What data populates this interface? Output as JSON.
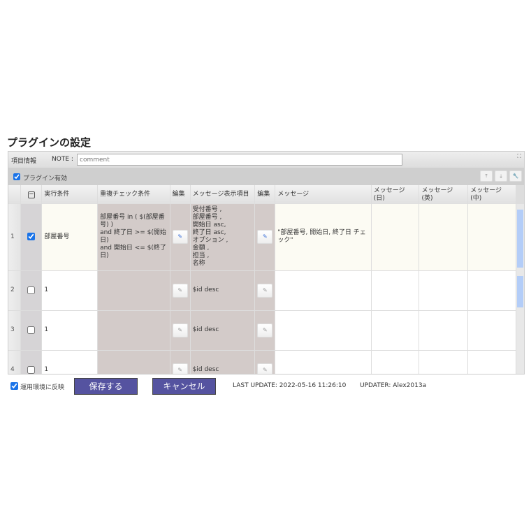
{
  "title": "プラグインの設定",
  "note": {
    "label": "項目情報",
    "note_label": "NOTE :",
    "value": "",
    "placeholder": "comment"
  },
  "plugin_enabled": {
    "label": "プラグイン有効",
    "checked": true
  },
  "toolbar": {
    "icons": [
      "move-top-icon",
      "move-bottom-icon",
      "wrench-icon"
    ]
  },
  "columns": [
    "実行条件",
    "重複チェック条件",
    "編集",
    "メッセージ表示項目",
    "編集",
    "メッセージ",
    "メッセージ\n(日)",
    "メッセージ\n(英)",
    "メッセージ\n(中)"
  ],
  "rows": [
    {
      "num": "1",
      "checked": true,
      "cond": "部屋番号",
      "dup": "部屋番号 in ( $(部屋番号) )\nand 終了日 >= $(開始日)\nand 開始日 <= $(終了日)",
      "items": "受付番号 ,\n部屋番号 ,\n開始日 asc,\n終了日 asc,\nオプション ,\n金額 ,\n担当 ,\n名称",
      "msg": "\"部屋番号, 開始日, 終了日 チェック\"",
      "msg_ja": "",
      "msg_en": "",
      "msg_zh": ""
    },
    {
      "num": "2",
      "checked": false,
      "cond": "1",
      "dup": "",
      "items": "$id desc",
      "msg": "",
      "msg_ja": "",
      "msg_en": "",
      "msg_zh": ""
    },
    {
      "num": "3",
      "checked": false,
      "cond": "1",
      "dup": "",
      "items": "$id desc",
      "msg": "",
      "msg_ja": "",
      "msg_en": "",
      "msg_zh": ""
    },
    {
      "num": "4",
      "checked": false,
      "cond": "1",
      "dup": "",
      "items": "$id desc",
      "msg": "",
      "msg_ja": "",
      "msg_en": "",
      "msg_zh": ""
    }
  ],
  "footer": {
    "reflect_label": "運用環境に反映",
    "reflect_checked": true,
    "save": "保存する",
    "cancel": "キャンセル",
    "last_update": "LAST UPDATE: 2022-05-16 11:26:10",
    "updater": "UPDATER: Alex2013a"
  }
}
